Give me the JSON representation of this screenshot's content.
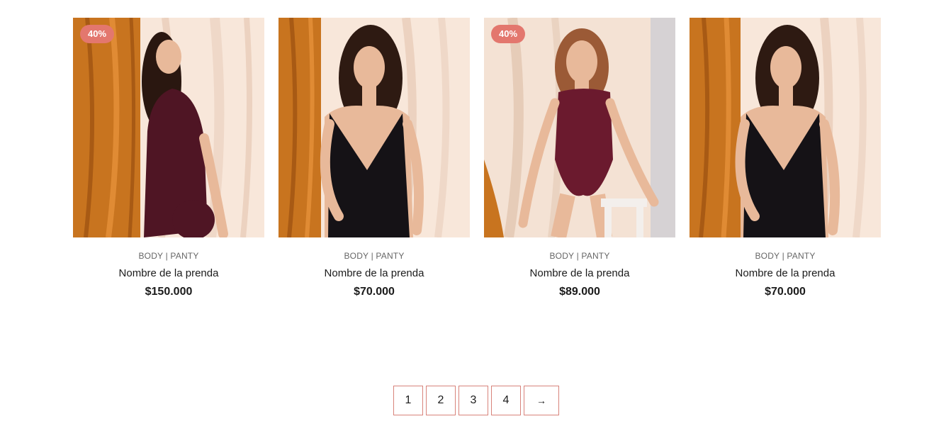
{
  "products": [
    {
      "badge": "40%",
      "category": "BODY | PANTY",
      "name": "Nombre de la prenda",
      "price": "$150.000",
      "garment_color": "#4f1524"
    },
    {
      "badge": "",
      "category": "BODY | PANTY",
      "name": "Nombre de la prenda",
      "price": "$70.000",
      "garment_color": "#151216"
    },
    {
      "badge": "40%",
      "category": "BODY | PANTY",
      "name": "Nombre de la prenda",
      "price": "$89.000",
      "garment_color": "#6b1a2e"
    },
    {
      "badge": "",
      "category": "BODY | PANTY",
      "name": "Nombre de la prenda",
      "price": "$70.000",
      "garment_color": "#151216"
    }
  ],
  "pagination": {
    "pages": [
      "1",
      "2",
      "3",
      "4"
    ],
    "next_icon": "arrow-right-icon",
    "next_glyph": "→"
  },
  "colors": {
    "badge": "#e3776e",
    "pagination_border": "#d8837b",
    "curtain_orange": "#c8741f",
    "backdrop_cream": "#f7e6d8"
  }
}
